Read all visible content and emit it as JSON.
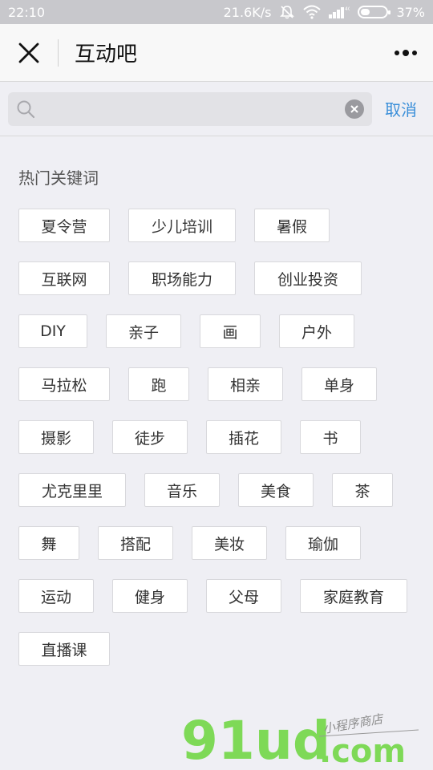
{
  "status_bar": {
    "time": "22:10",
    "network_speed": "21.6K/s",
    "signal_label": "4G",
    "battery": "37%",
    "battery_level": 0.37,
    "icons": [
      "mute-bell-icon",
      "wifi-icon",
      "signal-icon",
      "battery-icon"
    ]
  },
  "nav": {
    "title": "互动吧",
    "close_icon": "close-icon",
    "more_icon": "more-dots-icon"
  },
  "search": {
    "placeholder": "",
    "value": "",
    "cancel_label": "取消"
  },
  "hot": {
    "title": "热门关键词",
    "rows": [
      [
        "夏令营",
        "少儿培训",
        "暑假"
      ],
      [
        "互联网",
        "职场能力",
        "创业投资"
      ],
      [
        "DIY",
        "亲子",
        "画",
        "户外"
      ],
      [
        "马拉松",
        "跑",
        "相亲",
        "单身"
      ],
      [
        "摄影",
        "徒步",
        "插花",
        "书"
      ],
      [
        "尤克里里",
        "音乐",
        "美食",
        "茶"
      ],
      [
        "舞",
        "搭配",
        "美妆",
        "瑜伽"
      ],
      [
        "运动",
        "健身",
        "父母",
        "家庭教育"
      ],
      [
        "直播课"
      ]
    ]
  },
  "watermark": {
    "brand": "91ud",
    "domain": ".com",
    "tagline": "小程序商店"
  },
  "colors": {
    "background": "#efeff4",
    "accent": "#3b8fd9",
    "watermark_green": "#7ed957"
  }
}
